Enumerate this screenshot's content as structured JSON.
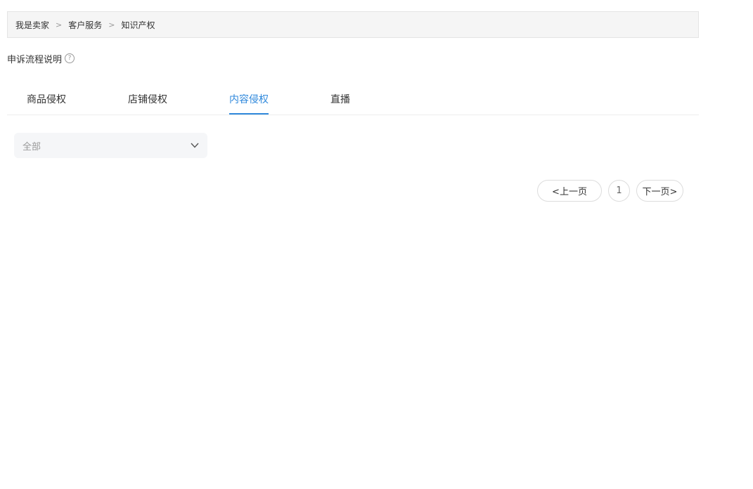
{
  "breadcrumb": {
    "items": [
      "我是卖家",
      "客户服务",
      "知识产权"
    ],
    "separator": ">"
  },
  "appeal": {
    "label": "申诉流程说明",
    "help_icon": "question-circle-icon",
    "help_glyph": "?"
  },
  "tabs": {
    "items": [
      {
        "label": "商品侵权",
        "active": false
      },
      {
        "label": "店铺侵权",
        "active": false
      },
      {
        "label": "内容侵权",
        "active": true
      },
      {
        "label": "直播",
        "active": false
      }
    ]
  },
  "filter": {
    "selected": "全部",
    "icon": "chevron-down-icon"
  },
  "pagination": {
    "prev_label": "<上一页",
    "current_page": "1",
    "next_label": "下一页>"
  },
  "colors": {
    "accent": "#3089dc",
    "breadcrumb_bg": "#f5f5f5",
    "select_bg": "#f5f6f8",
    "muted_text": "#999999"
  }
}
